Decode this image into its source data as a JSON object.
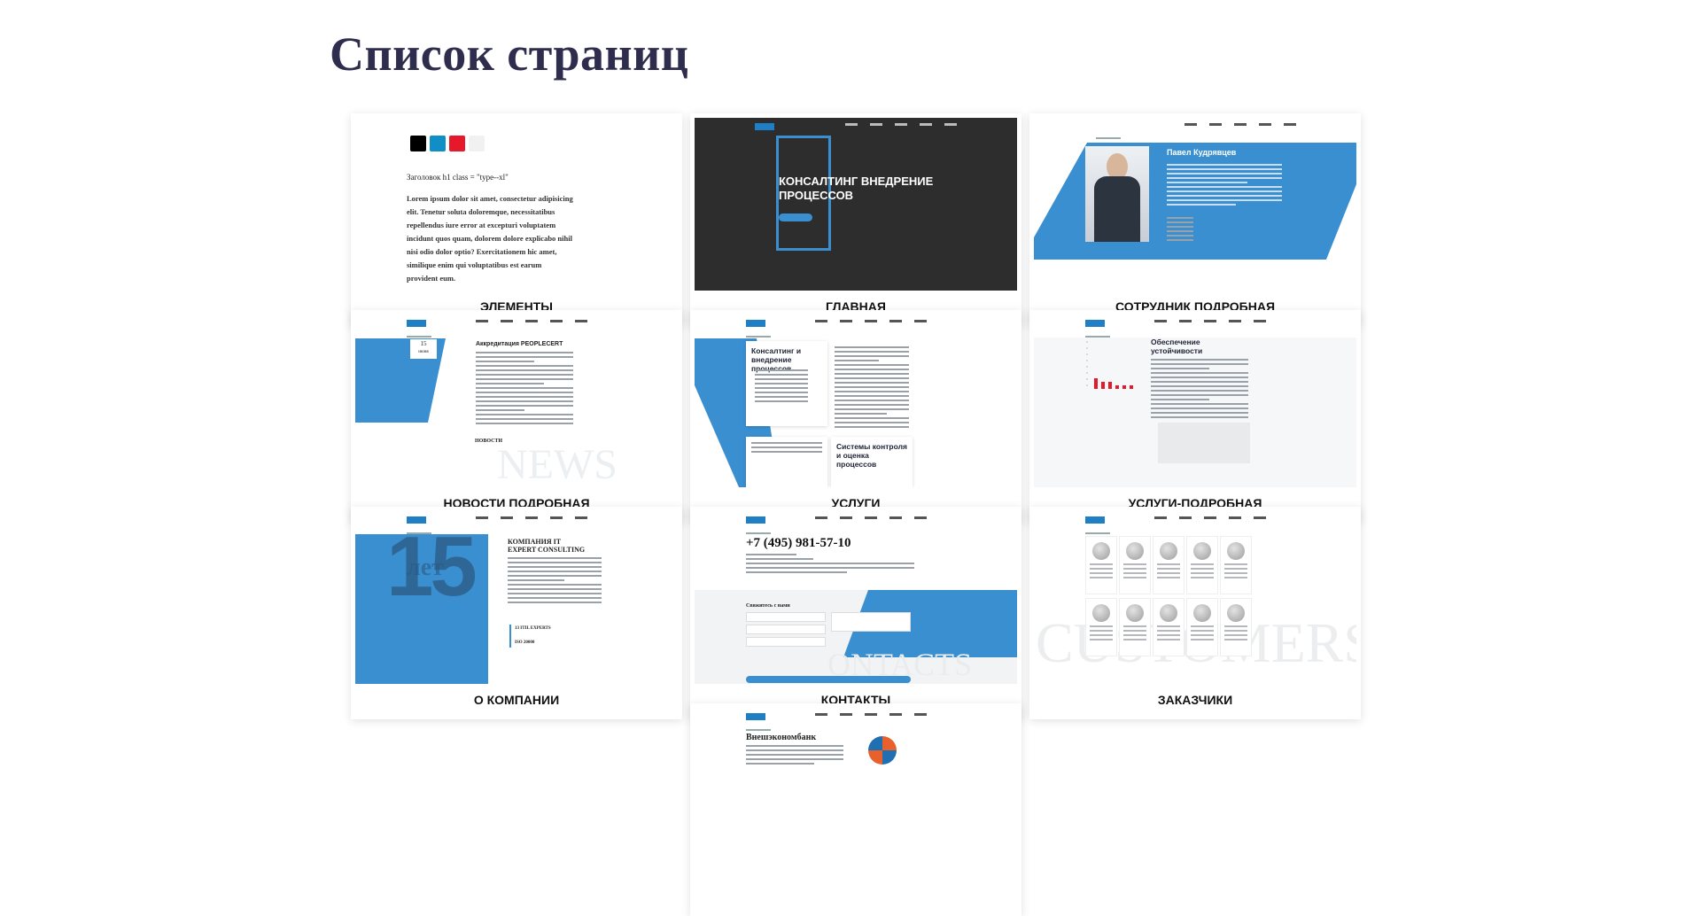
{
  "page": {
    "title": "Список страниц"
  },
  "cards": [
    {
      "label": "Элементы"
    },
    {
      "label": "Главная"
    },
    {
      "label": "Сотрудник подробная"
    },
    {
      "label": "Новости подробная"
    },
    {
      "label": "Услуги"
    },
    {
      "label": "Услуги-подробная"
    },
    {
      "label": "О компании"
    },
    {
      "label": "Контакты"
    },
    {
      "label": "Заказчики"
    },
    {
      "label": ""
    }
  ],
  "thumbs": {
    "elements": {
      "swatch_colors": [
        "#000000",
        "#0f8fc6",
        "#e5192a",
        "#f1f1f1"
      ],
      "heading": "Заголовок h1 class = \"type--xl\"",
      "body_text": "Lorem ipsum dolor sit amet, consectetur adipisicing elit. Tenetur soluta doloremque, necessitatibus repellendus iure error at excepturi voluptatem incidunt quos quam, dolorem dolore explicabo nihil nisi odio dolor optio? Exercitationem hic amet, similique enim qui voluptatibus est earum provident eum."
    },
    "main": {
      "hero_title": "КОНСАЛТИНГ ВНЕДРЕНИЕ ПРОЦЕССОВ"
    },
    "employee": {
      "name": "Павел Кудрявцев"
    },
    "news": {
      "date_day": "15",
      "date_month": "июня",
      "title": "Аккредитация PEOPLECERT",
      "section": "НОВОСТИ",
      "watermark": "NEWS"
    },
    "services": {
      "box1_title": "Консалтинг и внедрение процессов",
      "box2_title": "Системы контроля и оценка процессов"
    },
    "service_detail": {
      "title": "Обеспечение устойчивости",
      "chart_bars": [
        3,
        2,
        2,
        1,
        1,
        1
      ]
    },
    "about": {
      "number": "15",
      "suffix": "лет",
      "title": "КОМПАНИЯ IT EXPERT CONSULTING",
      "stat1": "13 ITIL EXPERTS",
      "stat2": "ISO 20000"
    },
    "contacts": {
      "phone": "+7 (495) 981-57-10",
      "form_title": "Свяжитесь с нами",
      "watermark": "ONTACTS"
    },
    "customers": {
      "watermark": "CUSTOMERS",
      "count": 10
    },
    "bank": {
      "title": "Внешэкономбанк"
    }
  },
  "colors": {
    "accent": "#3a8fd0",
    "title": "#2f2d4e",
    "dark": "#2d2d2d"
  }
}
